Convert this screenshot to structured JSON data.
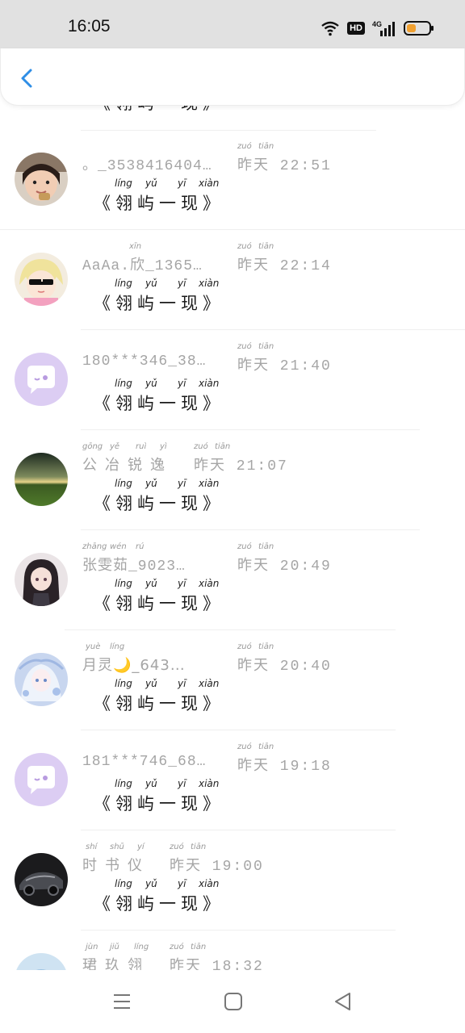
{
  "status": {
    "time": "16:05",
    "hd": "HD",
    "network": "4G"
  },
  "colors": {
    "accent": "#2f8ee6",
    "name_gray": "#a5a5a5",
    "message": "#1a1a1a"
  },
  "icons": {
    "back": "chevron-left-icon",
    "wifi": "wifi-icon",
    "signal": "signal-icon",
    "battery": "battery-icon",
    "menu": "menu-icon",
    "home": "home-icon",
    "back_nav": "back-triangle-icon"
  },
  "message": {
    "text": "《翎屿一现》",
    "pinyin": [
      "líng",
      "yǔ",
      "yī",
      "xiàn"
    ]
  },
  "time_pinyin": [
    "zuó",
    "tiān"
  ],
  "items": [
    {
      "name": "",
      "name_pinyin": [],
      "time": "",
      "avatar": "partial"
    },
    {
      "name": "。_3538416404…",
      "name_pinyin": [],
      "time": "昨天 22:51",
      "avatar": "child-photo"
    },
    {
      "name": "AaAa.欣_1365…",
      "name_pinyin": [
        "xīn"
      ],
      "time": "昨天 22:14",
      "avatar": "anime-sunglasses"
    },
    {
      "name": "180***346_38…",
      "name_pinyin": [],
      "time": "昨天 21:40",
      "avatar": "default-chat-bubble"
    },
    {
      "name": "公冶锐逸",
      "name_pinyin": [
        "gōng",
        "yě",
        "ruì",
        "yì"
      ],
      "time": "昨天 21:07",
      "avatar": "landscape"
    },
    {
      "name": "张雯茹_9023…",
      "name_pinyin": [
        "zhāng",
        "wén",
        "rú"
      ],
      "time": "昨天 20:49",
      "avatar": "anime-girl-dark"
    },
    {
      "name": "月灵🌙_643…",
      "name_pinyin": [
        "yuè",
        "líng"
      ],
      "time": "昨天 20:40",
      "avatar": "anime-girl-light"
    },
    {
      "name": "181***746_68…",
      "name_pinyin": [],
      "time": "昨天 19:18",
      "avatar": "default-chat-bubble"
    },
    {
      "name": "时书仪",
      "name_pinyin": [
        "shí",
        "shū",
        "yí"
      ],
      "time": "昨天 19:00",
      "avatar": "car"
    },
    {
      "name": "珺玖翎",
      "name_pinyin": [
        "jùn",
        "jiǔ",
        "líng"
      ],
      "time": "昨天 18:32",
      "avatar": "partial-blue"
    }
  ]
}
